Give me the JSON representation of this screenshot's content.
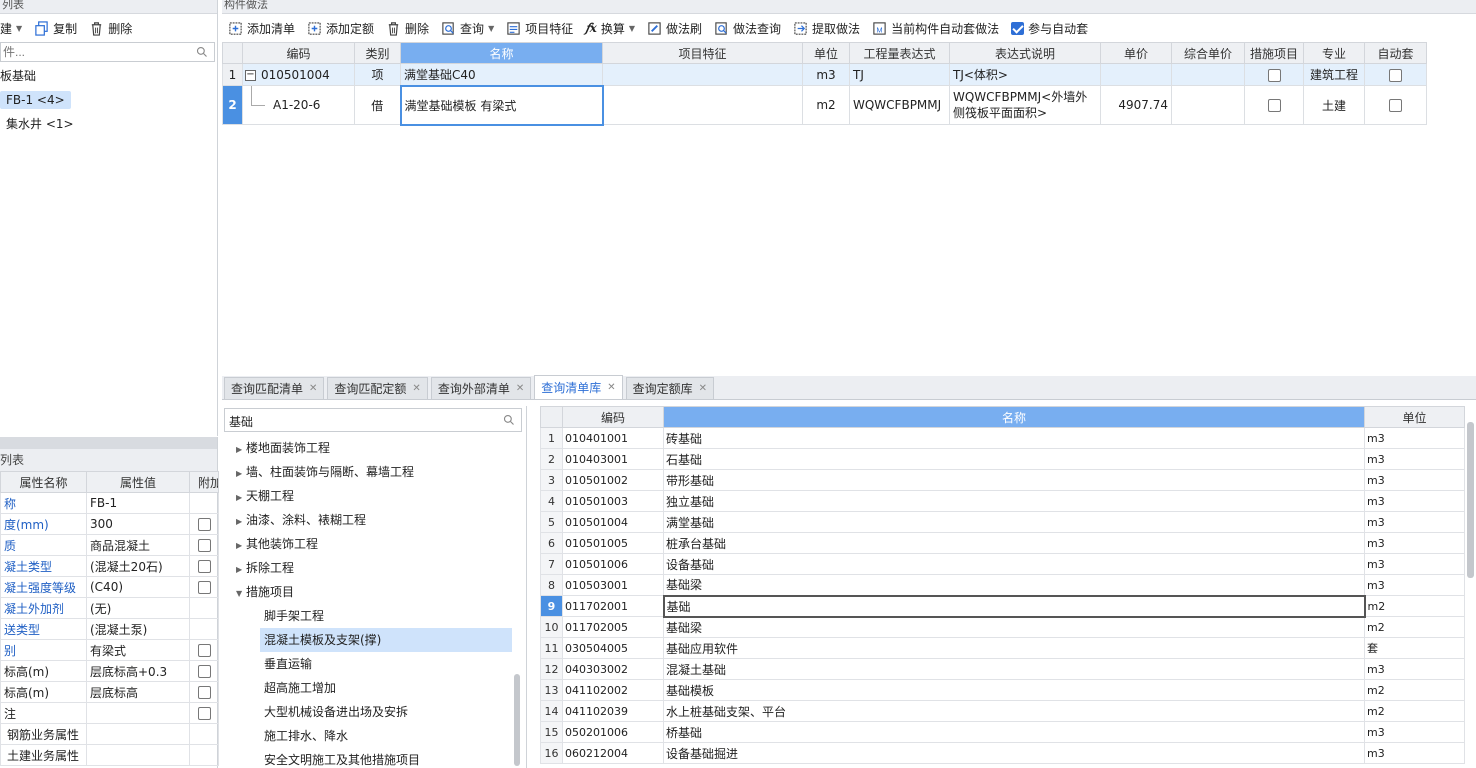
{
  "left_top": {
    "title": "列表",
    "toolbar": {
      "new_label": "建",
      "copy_label": "复制",
      "delete_label": "删除"
    },
    "search_placeholder": "件...",
    "tree": {
      "root": "板基础",
      "item1": "FB-1 <4>",
      "item2": "集水井 <1>"
    }
  },
  "left_bottom": {
    "title": "列表",
    "headers": {
      "name": "属性名称",
      "value": "属性值",
      "extra": "附加"
    },
    "rows": [
      {
        "name": "称",
        "value": "FB-1",
        "blue": true,
        "chk": false
      },
      {
        "name": "度(mm)",
        "value": "300",
        "blue": true,
        "chk": true
      },
      {
        "name": "质",
        "value": "商品混凝土",
        "blue": true,
        "chk": true
      },
      {
        "name": "凝土类型",
        "value": "(混凝土20石)",
        "blue": true,
        "chk": true
      },
      {
        "name": "凝土强度等级",
        "value": "(C40)",
        "blue": true,
        "chk": true
      },
      {
        "name": "凝土外加剂",
        "value": "(无)",
        "blue": true,
        "chk": false
      },
      {
        "name": "送类型",
        "value": "(混凝土泵)",
        "blue": true,
        "chk": false
      },
      {
        "name": "别",
        "value": "有梁式",
        "blue": true,
        "chk": true
      },
      {
        "name": "标高(m)",
        "value": "层底标高+0.3",
        "blue": false,
        "chk": true
      },
      {
        "name": "标高(m)",
        "value": "层底标高",
        "blue": false,
        "chk": true
      },
      {
        "name": "注",
        "value": "",
        "blue": false,
        "chk": true
      },
      {
        "name": "钢筋业务属性",
        "value": "",
        "blue": false,
        "chk": false
      },
      {
        "name": "土建业务属性",
        "value": "",
        "blue": false,
        "chk": false
      }
    ]
  },
  "main": {
    "title": "构件做法",
    "toolbar": {
      "add_list": "添加清单",
      "add_quota": "添加定额",
      "delete": "删除",
      "query": "查询",
      "item_feature": "项目特征",
      "convert": "换算",
      "method_brush": "做法刷",
      "method_query": "做法查询",
      "extract_method": "提取做法",
      "auto_method": "当前构件自动套做法",
      "participate_auto": "参与自动套"
    },
    "headers": {
      "code": "编码",
      "type": "类别",
      "name": "名称",
      "feature": "项目特征",
      "unit": "单位",
      "expr": "工程量表达式",
      "expr_desc": "表达式说明",
      "price": "单价",
      "total_price": "综合单价",
      "measure": "措施项目",
      "major": "专业",
      "auto": "自动套"
    },
    "rows": [
      {
        "idx": "1",
        "code": "010501004",
        "type": "项",
        "name": "满堂基础C40",
        "feature": "",
        "unit": "m3",
        "expr": "TJ",
        "expr_desc": "TJ<体积>",
        "price": "",
        "total": "",
        "major": "建筑工程"
      },
      {
        "idx": "2",
        "code": "A1-20-6",
        "type": "借",
        "name": "满堂基础模板 有梁式",
        "feature": "",
        "unit": "m2",
        "expr": "WQWCFBPMMJ",
        "expr_desc": "WQWCFBPMMJ<外墙外侧筏板平面面积>",
        "price": "4907.74",
        "total": "",
        "major": "土建"
      }
    ]
  },
  "bottom": {
    "tabs": [
      "查询匹配清单",
      "查询匹配定额",
      "查询外部清单",
      "查询清单库",
      "查询定额库"
    ],
    "search_value": "基础",
    "tree": [
      {
        "label": "楼地面装饰工程",
        "level": 0,
        "arrow": "▶"
      },
      {
        "label": "墙、柱面装饰与隔断、幕墙工程",
        "level": 0,
        "arrow": "▶"
      },
      {
        "label": "天棚工程",
        "level": 0,
        "arrow": "▶"
      },
      {
        "label": "油漆、涂料、裱糊工程",
        "level": 0,
        "arrow": "▶"
      },
      {
        "label": "其他装饰工程",
        "level": 0,
        "arrow": "▶"
      },
      {
        "label": "拆除工程",
        "level": 0,
        "arrow": "▶"
      },
      {
        "label": "措施项目",
        "level": 0,
        "arrow": "▼"
      },
      {
        "label": "脚手架工程",
        "level": 1,
        "arrow": ""
      },
      {
        "label": "混凝土模板及支架(撑)",
        "level": 1,
        "arrow": "",
        "selected": true
      },
      {
        "label": "垂直运输",
        "level": 1,
        "arrow": ""
      },
      {
        "label": "超高施工增加",
        "level": 1,
        "arrow": ""
      },
      {
        "label": "大型机械设备进出场及安拆",
        "level": 1,
        "arrow": ""
      },
      {
        "label": "施工排水、降水",
        "level": 1,
        "arrow": ""
      },
      {
        "label": "安全文明施工及其他措施项目",
        "level": 1,
        "arrow": ""
      }
    ],
    "lib_headers": {
      "code": "编码",
      "name": "名称",
      "unit": "单位"
    },
    "lib_rows": [
      {
        "idx": "1",
        "code": "010401001",
        "name": "砖基础",
        "unit": "m3"
      },
      {
        "idx": "2",
        "code": "010403001",
        "name": "石基础",
        "unit": "m3"
      },
      {
        "idx": "3",
        "code": "010501002",
        "name": "带形基础",
        "unit": "m3"
      },
      {
        "idx": "4",
        "code": "010501003",
        "name": "独立基础",
        "unit": "m3"
      },
      {
        "idx": "5",
        "code": "010501004",
        "name": "满堂基础",
        "unit": "m3"
      },
      {
        "idx": "6",
        "code": "010501005",
        "name": "桩承台基础",
        "unit": "m3"
      },
      {
        "idx": "7",
        "code": "010501006",
        "name": "设备基础",
        "unit": "m3"
      },
      {
        "idx": "8",
        "code": "010503001",
        "name": "基础梁",
        "unit": "m3"
      },
      {
        "idx": "9",
        "code": "011702001",
        "name": "基础",
        "unit": "m2",
        "selected": true
      },
      {
        "idx": "10",
        "code": "011702005",
        "name": "基础梁",
        "unit": "m2"
      },
      {
        "idx": "11",
        "code": "030504005",
        "name": "基础应用软件",
        "unit": "套"
      },
      {
        "idx": "12",
        "code": "040303002",
        "name": "混凝土基础",
        "unit": "m3"
      },
      {
        "idx": "13",
        "code": "041102002",
        "name": "基础模板",
        "unit": "m2"
      },
      {
        "idx": "14",
        "code": "041102039",
        "name": "水上桩基础支架、平台",
        "unit": "m2"
      },
      {
        "idx": "15",
        "code": "050201006",
        "name": "桥基础",
        "unit": "m3"
      },
      {
        "idx": "16",
        "code": "060212004",
        "name": "设备基础掘进",
        "unit": "m3"
      }
    ]
  }
}
